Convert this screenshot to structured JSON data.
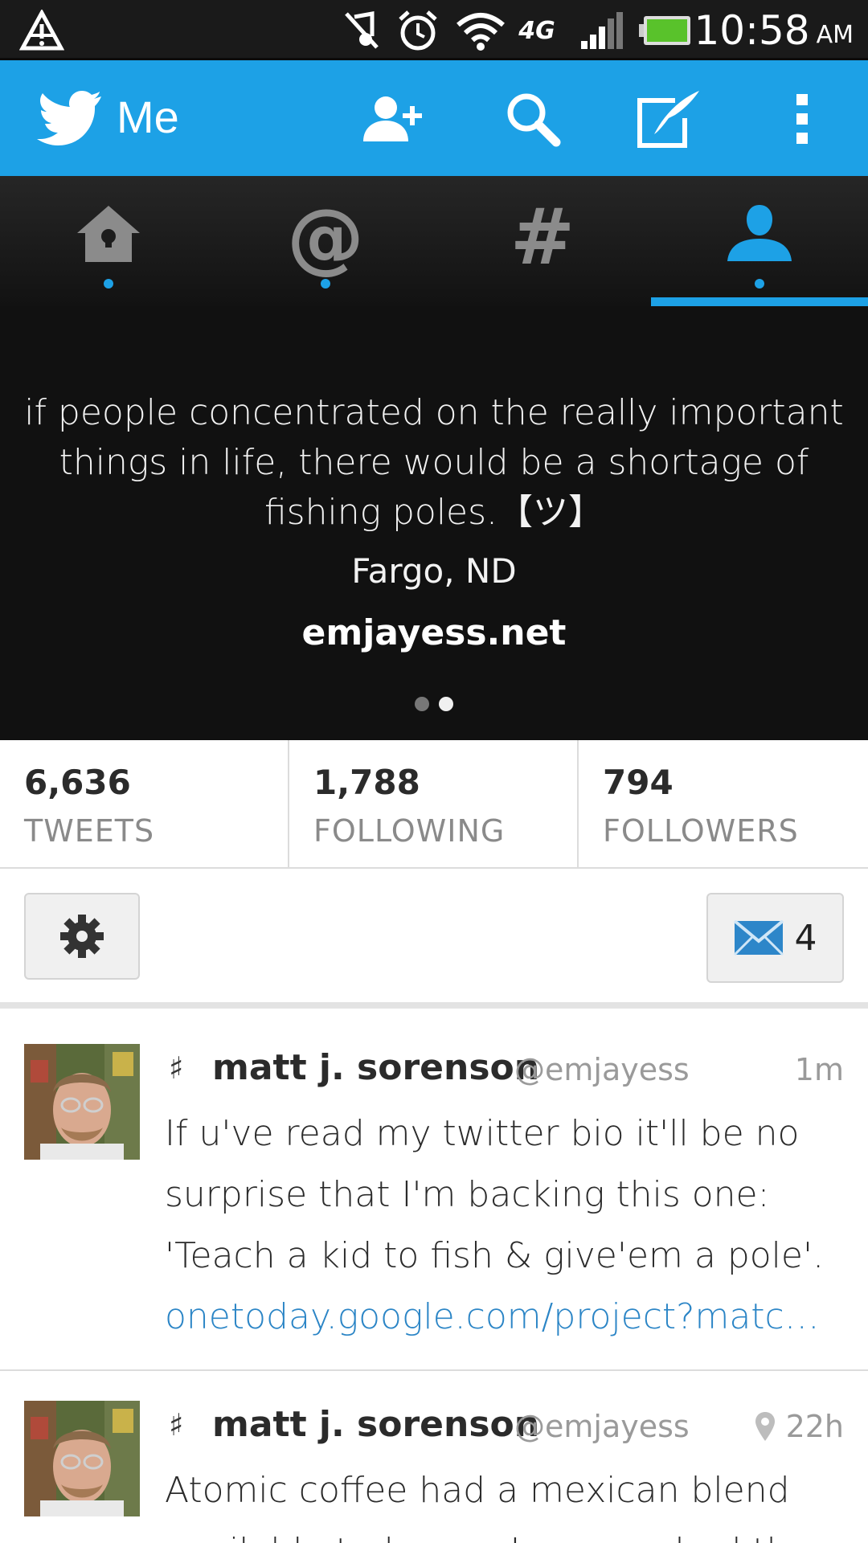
{
  "status_bar": {
    "time": "10:58",
    "ampm": "AM",
    "network": "4G",
    "icons": [
      "warning-triangle-icon",
      "muted-music-icon",
      "alarm-icon",
      "wifi-icon",
      "signal-icon",
      "battery-icon"
    ]
  },
  "action_bar": {
    "title": "Me",
    "icons": [
      "twitter-bird-icon",
      "add-user-icon",
      "search-icon",
      "compose-icon",
      "overflow-menu-icon"
    ],
    "accent": "#1da1e6"
  },
  "tabs": [
    {
      "name": "home",
      "icon": "home-icon",
      "has_dot": true,
      "selected": false
    },
    {
      "name": "mentions",
      "icon": "at-icon",
      "glyph": "@",
      "has_dot": true,
      "selected": false
    },
    {
      "name": "discover",
      "icon": "hashtag-icon",
      "glyph": "#",
      "has_dot": false,
      "selected": false
    },
    {
      "name": "me",
      "icon": "profile-icon",
      "has_dot": true,
      "selected": true
    }
  ],
  "profile": {
    "bio": "if people concentrated on the really important things in life, there would be a shortage of fishing poles.【ツ】",
    "location": "Fargo, ND",
    "url": "emjayess.net",
    "page": 2,
    "page_count": 2
  },
  "stats": [
    {
      "value": "6,636",
      "label": "TWEETS"
    },
    {
      "value": "1,788",
      "label": "FOLLOWING"
    },
    {
      "value": "794",
      "label": "FOLLOWERS"
    }
  ],
  "controls": {
    "settings_icon": "gear-icon",
    "messages_icon": "envelope-icon",
    "messages_count": "4"
  },
  "tweets": [
    {
      "retweet_icon": "♯",
      "name": "matt j. sorenson",
      "handle": "@emjayess",
      "time": "1m",
      "has_location": false,
      "text": "If u've read my twitter bio it'll be no surprise that I'm backing this one: 'Teach a kid to fish & give'em a pole'.",
      "link": "onetoday.google.com/project?match=..."
    },
    {
      "retweet_icon": "♯",
      "name": "matt j. sorenson",
      "handle": "@emjayess",
      "time": "22h",
      "has_location": true,
      "text": "Atomic coffee had a mexican blend available today, so I approached the",
      "link": ""
    }
  ]
}
